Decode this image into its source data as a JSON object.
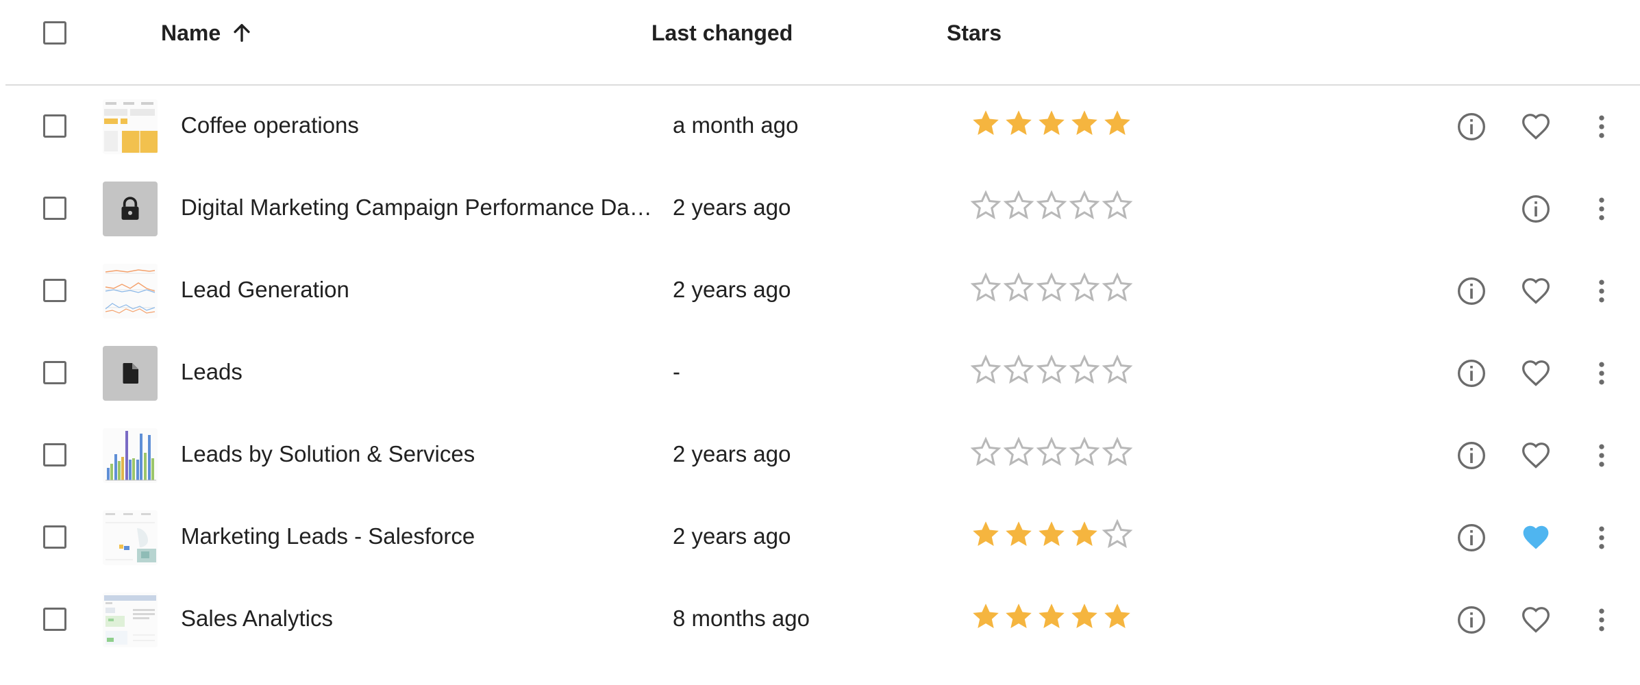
{
  "header": {
    "name_label": "Name",
    "last_changed_label": "Last changed",
    "stars_label": "Stars",
    "sort_direction": "ascending"
  },
  "colors": {
    "star_filled": "#f5b53f",
    "star_empty": "#b8b8b8",
    "favorite_active": "#4fb5f0",
    "icon_gray": "#6b6b6b"
  },
  "rows": [
    {
      "name": "Coffee operations",
      "last_changed": "a month ago",
      "stars": 5,
      "thumbnail": "dashboard-thumbnail",
      "favorite": false,
      "favoritable": true
    },
    {
      "name": "Digital Marketing Campaign Performance Dash…",
      "last_changed": "2 years ago",
      "stars": 0,
      "thumbnail": "lock-icon",
      "favorite": false,
      "favoritable": false
    },
    {
      "name": "Lead Generation",
      "last_changed": "2 years ago",
      "stars": 0,
      "thumbnail": "dashboard-thumbnail",
      "favorite": false,
      "favoritable": true
    },
    {
      "name": "Leads",
      "last_changed": "-",
      "stars": 0,
      "thumbnail": "document-icon",
      "favorite": false,
      "favoritable": true
    },
    {
      "name": "Leads by Solution & Services",
      "last_changed": "2 years ago",
      "stars": 0,
      "thumbnail": "bar-chart-thumbnail",
      "favorite": false,
      "favoritable": true
    },
    {
      "name": "Marketing Leads - Salesforce",
      "last_changed": "2 years ago",
      "stars": 4,
      "thumbnail": "dashboard-thumbnail",
      "favorite": true,
      "favoritable": true
    },
    {
      "name": "Sales Analytics",
      "last_changed": "8 months ago",
      "stars": 5,
      "thumbnail": "dashboard-thumbnail",
      "favorite": false,
      "favoritable": true
    }
  ]
}
